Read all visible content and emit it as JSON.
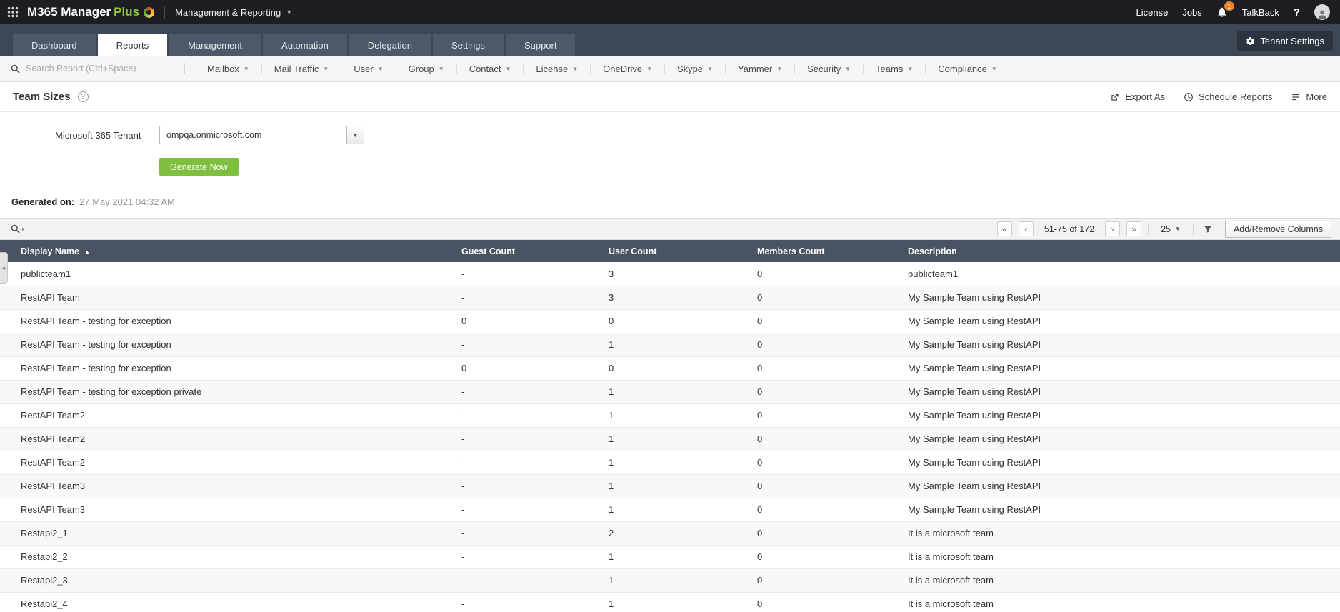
{
  "topbar": {
    "logo_m365": "M365 Manager",
    "logo_plus": "Plus",
    "context": "Management & Reporting",
    "license_label": "License",
    "jobs_label": "Jobs",
    "notification_count": "1",
    "talkback_label": "TalkBack",
    "help_label": "?"
  },
  "tabs": {
    "items": [
      {
        "label": "Dashboard",
        "active": false
      },
      {
        "label": "Reports",
        "active": true
      },
      {
        "label": "Management",
        "active": false
      },
      {
        "label": "Automation",
        "active": false
      },
      {
        "label": "Delegation",
        "active": false
      },
      {
        "label": "Settings",
        "active": false
      },
      {
        "label": "Support",
        "active": false
      }
    ],
    "tenant_settings_label": "Tenant Settings"
  },
  "menubar": {
    "search_placeholder": "Search Report (Ctrl+Space)",
    "items": [
      "Mailbox",
      "Mail Traffic",
      "User",
      "Group",
      "Contact",
      "License",
      "OneDrive",
      "Skype",
      "Yammer",
      "Security",
      "Teams",
      "Compliance"
    ]
  },
  "page": {
    "title": "Team Sizes",
    "help": "?",
    "actions": {
      "export": "Export As",
      "schedule": "Schedule Reports",
      "more": "More"
    }
  },
  "form": {
    "tenant_label": "Microsoft 365 Tenant",
    "tenant_value": "ompqa.onmicrosoft.com",
    "generate_label": "Generate Now",
    "generated_on_label": "Generated on:",
    "generated_on_value": "27 May 2021 04:32 AM"
  },
  "table": {
    "pagination": {
      "range": "51-75 of 172",
      "page_size": "25"
    },
    "add_remove_label": "Add/Remove Columns",
    "columns": [
      "Display Name",
      "Guest Count",
      "User Count",
      "Members Count",
      "Description"
    ],
    "sorted_column": "Display Name",
    "rows": [
      [
        "publicteam1",
        "-",
        "3",
        "0",
        "publicteam1"
      ],
      [
        "RestAPI Team",
        "-",
        "3",
        "0",
        "My Sample Team using RestAPI"
      ],
      [
        "RestAPI Team - testing for exception",
        "0",
        "0",
        "0",
        "My Sample Team using RestAPI"
      ],
      [
        "RestAPI Team - testing for exception",
        "-",
        "1",
        "0",
        "My Sample Team using RestAPI"
      ],
      [
        "RestAPI Team - testing for exception",
        "0",
        "0",
        "0",
        "My Sample Team using RestAPI"
      ],
      [
        "RestAPI Team - testing for exception private",
        "-",
        "1",
        "0",
        "My Sample Team using RestAPI"
      ],
      [
        "RestAPI Team2",
        "-",
        "1",
        "0",
        "My Sample Team using RestAPI"
      ],
      [
        "RestAPI Team2",
        "-",
        "1",
        "0",
        "My Sample Team using RestAPI"
      ],
      [
        "RestAPI Team2",
        "-",
        "1",
        "0",
        "My Sample Team using RestAPI"
      ],
      [
        "RestAPI Team3",
        "-",
        "1",
        "0",
        "My Sample Team using RestAPI"
      ],
      [
        "RestAPI Team3",
        "-",
        "1",
        "0",
        "My Sample Team using RestAPI"
      ],
      [
        "Restapi2_1",
        "-",
        "2",
        "0",
        "It is a microsoft team"
      ],
      [
        "Restapi2_2",
        "-",
        "1",
        "0",
        "It is a microsoft team"
      ],
      [
        "Restapi2_3",
        "-",
        "1",
        "0",
        "It is a microsoft team"
      ],
      [
        "Restapi2_4",
        "-",
        "1",
        "0",
        "It is a microsoft team"
      ]
    ]
  },
  "colors": {
    "topbar_bg": "#1d1d24",
    "tabbar_bg": "#3d4755",
    "accent_green": "#7fbf3f",
    "table_header_bg": "#495361",
    "badge_orange": "#f08125"
  }
}
